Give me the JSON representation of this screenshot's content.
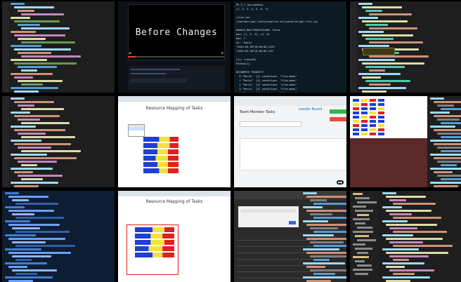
{
  "collage": {
    "tiles": [
      {
        "kind": "code-editor"
      },
      {
        "kind": "video",
        "title": "Before Changes"
      },
      {
        "kind": "terminal",
        "lines": [
          "PS C:\\ (pq-pandas)",
          "[1, 2, 3, 4, 5, 6, 7]",
          "",
          "slice_len",
          "(/workdir/ppl-lastk/pipeline-etl/parallel/ppl-fitc.py)",
          "",
          "ENABLE_MULTIPROCESSING: False",
          "min: [1, 2, 3], [4, 5]",
          "max: 7",
          "at: 'Gavin'",
          "\"2024-05-20T10:00:00.1231\"",
          "\"2024-05-20T10:00:00.123\"",
          "",
          "[1]: trees[0]",
          "Python[1]",
          "",
          "RECOMPUTE PRIORITY",
          "  0 \"Paris\"  [1] conditions  \"ilia-meas\"",
          "  1 \"Paris\"  [1] conditions  \"ilia-meas\"",
          "  2 \"Paris\"  [1] conditions  \"ilia-meas\"",
          "  3 \"Paris\"  [1] conditions  \"ilia-meas\"",
          "  4 \"Paris\"  [1] conditions  \"ilia-meas\""
        ]
      },
      {
        "kind": "code-editor"
      },
      {
        "kind": "code-editor"
      },
      {
        "kind": "browser-chart",
        "title": "Resource Mapping of Tasks"
      },
      {
        "kind": "web-app",
        "title": "Team Member Tasks",
        "title2": "Leader Board"
      },
      {
        "kind": "devtools"
      },
      {
        "kind": "code-editor"
      },
      {
        "kind": "browser-chart",
        "title": "Resource Mapping of Tasks"
      },
      {
        "kind": "dark-panel"
      },
      {
        "kind": "code-editor"
      }
    ]
  },
  "chart_data": [
    {
      "type": "bar",
      "title": "Resource Mapping of Tasks",
      "orientation": "horizontal",
      "stacked": true,
      "colors": [
        "#1f3fd8",
        "#f3e23a",
        "#e02020"
      ],
      "categories": [
        "",
        "",
        "",
        "",
        "",
        ""
      ],
      "series": [
        {
          "values": [
            0.45,
            0.4,
            0.4,
            0.35,
            0.4,
            0.45
          ]
        },
        {
          "values": [
            0.3,
            0.35,
            0.3,
            0.35,
            0.3,
            0.25
          ]
        },
        {
          "values": [
            0.25,
            0.25,
            0.3,
            0.3,
            0.3,
            0.3
          ]
        }
      ]
    },
    {
      "type": "bar",
      "title": "Resource Mapping of Tasks",
      "orientation": "horizontal",
      "stacked": true,
      "colors": [
        "#1f3fd8",
        "#f3e23a",
        "#e02020"
      ],
      "categories": [
        "",
        "",
        "",
        "",
        ""
      ],
      "series": [
        {
          "values": [
            0.45,
            0.4,
            0.4,
            0.35,
            0.45
          ]
        },
        {
          "values": [
            0.3,
            0.3,
            0.35,
            0.35,
            0.25
          ]
        },
        {
          "values": [
            0.25,
            0.3,
            0.25,
            0.3,
            0.3
          ]
        }
      ]
    }
  ],
  "icons": {
    "play": "play-icon",
    "gear": "gear-icon",
    "close": "close-icon"
  },
  "palette": {
    "editor_bg": "#1e1e1e",
    "terminal_bg": "#0c1a24",
    "accent_red": "#e02020",
    "accent_blue": "#1f3fd8",
    "accent_yellow": "#f3e23a"
  }
}
